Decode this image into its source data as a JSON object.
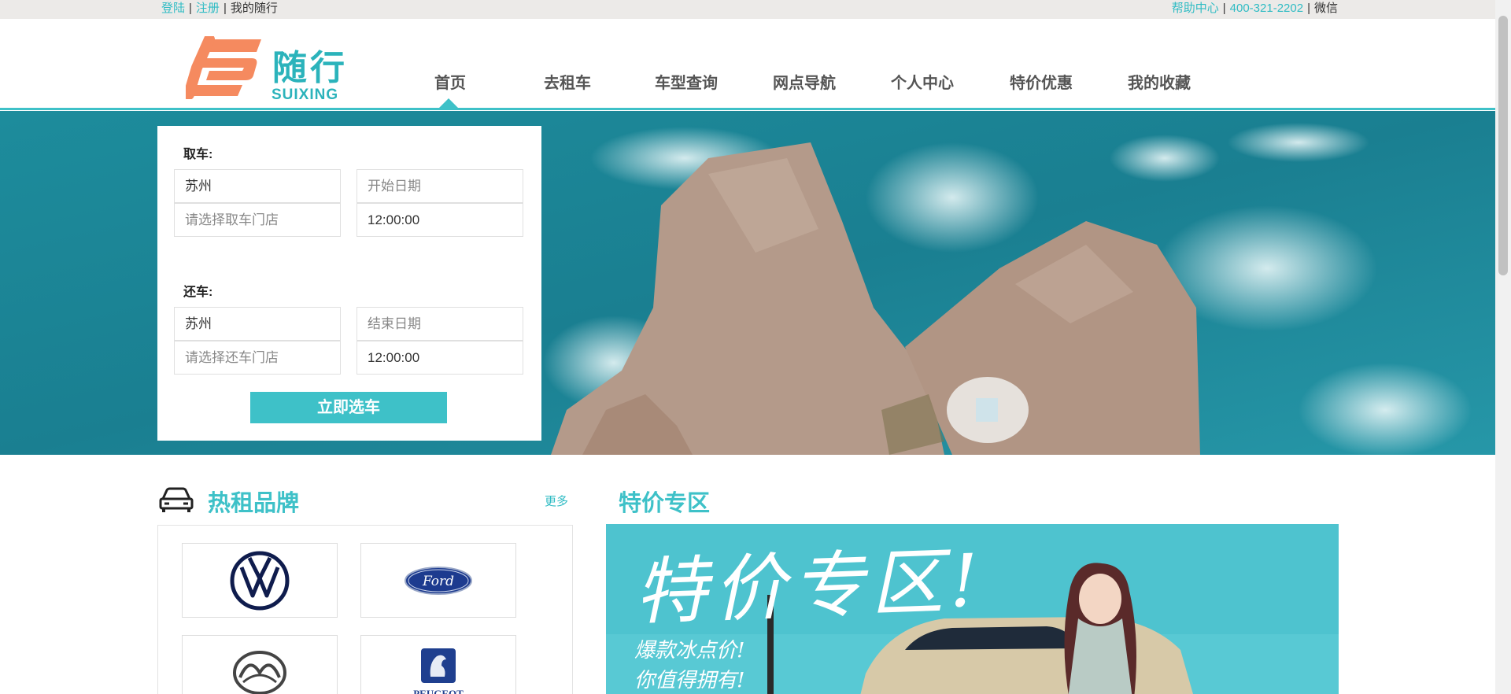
{
  "topbar": {
    "login": "登陆",
    "register": "注册",
    "my_trip": "我的随行",
    "help": "帮助中心",
    "phone": "400-321-2202",
    "wechat": "微信"
  },
  "logo": {
    "cn": "随行",
    "en": "SUIXING"
  },
  "nav": {
    "items": [
      "首页",
      "去租车",
      "车型查询",
      "网点导航",
      "个人中心",
      "特价优惠",
      "我的收藏"
    ],
    "active": "首页"
  },
  "booking": {
    "pickup_label": "取车:",
    "pickup_city": "苏州",
    "pickup_date_placeholder": "开始日期",
    "pickup_store_placeholder": "请选择取车门店",
    "pickup_time": "12:00:00",
    "return_label": "还车:",
    "return_city": "苏州",
    "return_date_placeholder": "结束日期",
    "return_store_placeholder": "请选择还车门店",
    "return_time": "12:00:00",
    "submit_label": "立即选车"
  },
  "hot_brands": {
    "title": "热租品牌",
    "more": "更多",
    "brands": [
      "Volkswagen",
      "Ford",
      "Mazda",
      "PEUGEOT"
    ]
  },
  "special": {
    "title": "特价专区",
    "banner_title": "特价专区!",
    "banner_line1": "爆款冰点价!",
    "banner_line2": "你值得拥有!"
  },
  "colors": {
    "accent": "#3ec1c8",
    "logo_orange": "#f58a5f",
    "topbar_bg": "#eceae8"
  }
}
